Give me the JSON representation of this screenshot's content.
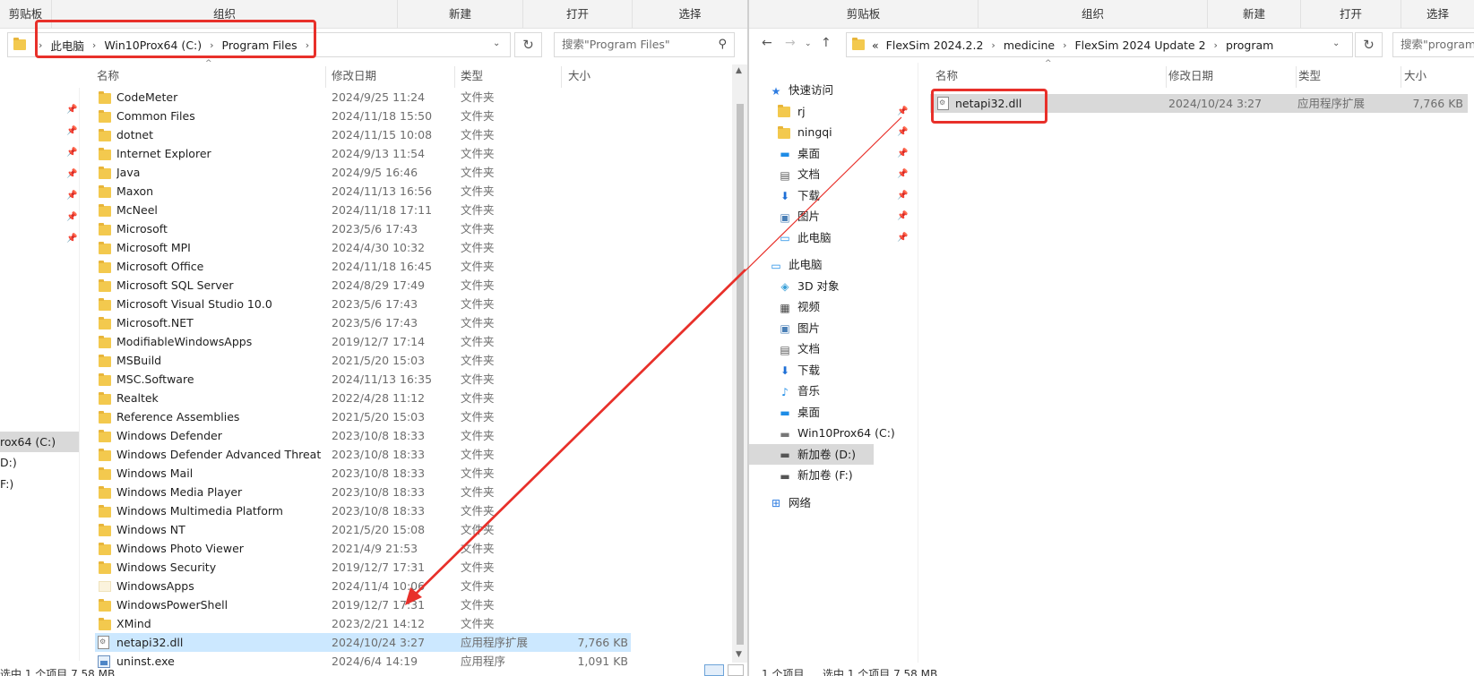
{
  "left": {
    "ribbon": [
      "剪贴板",
      "组织",
      "新建",
      "打开",
      "选择"
    ],
    "address": {
      "segments": [
        "此电脑",
        "Win10Prox64 (C:)",
        "Program Files"
      ]
    },
    "search_placeholder": "搜索\"Program Files\"",
    "columns": [
      "名称",
      "修改日期",
      "类型",
      "大小"
    ],
    "rows": [
      {
        "name": "CodeMeter",
        "date": "2024/9/25 11:24",
        "type": "文件夹",
        "size": "",
        "icon": "folder-icon"
      },
      {
        "name": "Common Files",
        "date": "2024/11/18 15:50",
        "type": "文件夹",
        "size": "",
        "icon": "folder-icon"
      },
      {
        "name": "dotnet",
        "date": "2024/11/15 10:08",
        "type": "文件夹",
        "size": "",
        "icon": "folder-icon"
      },
      {
        "name": "Internet Explorer",
        "date": "2024/9/13 11:54",
        "type": "文件夹",
        "size": "",
        "icon": "folder-icon"
      },
      {
        "name": "Java",
        "date": "2024/9/5 16:46",
        "type": "文件夹",
        "size": "",
        "icon": "folder-icon"
      },
      {
        "name": "Maxon",
        "date": "2024/11/13 16:56",
        "type": "文件夹",
        "size": "",
        "icon": "folder-icon"
      },
      {
        "name": "McNeel",
        "date": "2024/11/18 17:11",
        "type": "文件夹",
        "size": "",
        "icon": "folder-icon"
      },
      {
        "name": "Microsoft",
        "date": "2023/5/6 17:43",
        "type": "文件夹",
        "size": "",
        "icon": "folder-icon"
      },
      {
        "name": "Microsoft MPI",
        "date": "2024/4/30 10:32",
        "type": "文件夹",
        "size": "",
        "icon": "folder-icon"
      },
      {
        "name": "Microsoft Office",
        "date": "2024/11/18 16:45",
        "type": "文件夹",
        "size": "",
        "icon": "folder-icon"
      },
      {
        "name": "Microsoft SQL Server",
        "date": "2024/8/29 17:49",
        "type": "文件夹",
        "size": "",
        "icon": "folder-icon"
      },
      {
        "name": "Microsoft Visual Studio 10.0",
        "date": "2023/5/6 17:43",
        "type": "文件夹",
        "size": "",
        "icon": "folder-icon"
      },
      {
        "name": "Microsoft.NET",
        "date": "2023/5/6 17:43",
        "type": "文件夹",
        "size": "",
        "icon": "folder-icon"
      },
      {
        "name": "ModifiableWindowsApps",
        "date": "2019/12/7 17:14",
        "type": "文件夹",
        "size": "",
        "icon": "folder-icon"
      },
      {
        "name": "MSBuild",
        "date": "2021/5/20 15:03",
        "type": "文件夹",
        "size": "",
        "icon": "folder-icon"
      },
      {
        "name": "MSC.Software",
        "date": "2024/11/13 16:35",
        "type": "文件夹",
        "size": "",
        "icon": "folder-icon"
      },
      {
        "name": "Realtek",
        "date": "2022/4/28 11:12",
        "type": "文件夹",
        "size": "",
        "icon": "folder-icon"
      },
      {
        "name": "Reference Assemblies",
        "date": "2021/5/20 15:03",
        "type": "文件夹",
        "size": "",
        "icon": "folder-icon"
      },
      {
        "name": "Windows Defender",
        "date": "2023/10/8 18:33",
        "type": "文件夹",
        "size": "",
        "icon": "folder-icon"
      },
      {
        "name": "Windows Defender Advanced Threat ...",
        "date": "2023/10/8 18:33",
        "type": "文件夹",
        "size": "",
        "icon": "folder-icon"
      },
      {
        "name": "Windows Mail",
        "date": "2023/10/8 18:33",
        "type": "文件夹",
        "size": "",
        "icon": "folder-icon"
      },
      {
        "name": "Windows Media Player",
        "date": "2023/10/8 18:33",
        "type": "文件夹",
        "size": "",
        "icon": "folder-icon"
      },
      {
        "name": "Windows Multimedia Platform",
        "date": "2023/10/8 18:33",
        "type": "文件夹",
        "size": "",
        "icon": "folder-icon"
      },
      {
        "name": "Windows NT",
        "date": "2021/5/20 15:08",
        "type": "文件夹",
        "size": "",
        "icon": "folder-icon"
      },
      {
        "name": "Windows Photo Viewer",
        "date": "2021/4/9 21:53",
        "type": "文件夹",
        "size": "",
        "icon": "folder-icon"
      },
      {
        "name": "Windows Security",
        "date": "2019/12/7 17:31",
        "type": "文件夹",
        "size": "",
        "icon": "folder-icon"
      },
      {
        "name": "WindowsApps",
        "date": "2024/11/4 10:06",
        "type": "文件夹",
        "size": "",
        "icon": "windowsapps-folder-icon"
      },
      {
        "name": "WindowsPowerShell",
        "date": "2019/12/7 17:31",
        "type": "文件夹",
        "size": "",
        "icon": "folder-icon"
      },
      {
        "name": "XMind",
        "date": "2023/2/21 14:12",
        "type": "文件夹",
        "size": "",
        "icon": "folder-icon"
      },
      {
        "name": "netapi32.dll",
        "date": "2024/10/24 3:27",
        "type": "应用程序扩展",
        "size": "7,766 KB",
        "icon": "dll-file-icon",
        "selected": true
      },
      {
        "name": "uninst.exe",
        "date": "2024/6/4 14:19",
        "type": "应用程序",
        "size": "1,091 KB",
        "icon": "exe-file-icon"
      }
    ],
    "nav_fragments": [
      "rox64 (C:)",
      "D:)",
      "F:)"
    ],
    "status": "选中 1 个项目  7.58 MB"
  },
  "right": {
    "ribbon": [
      "剪贴板",
      "组织",
      "新建",
      "打开",
      "选择"
    ],
    "address": {
      "overflow": "«",
      "segments": [
        "FlexSim 2024.2.2",
        "medicine",
        "FlexSim 2024 Update 2",
        "program"
      ]
    },
    "search_placeholder": "搜索\"program",
    "columns": [
      "名称",
      "修改日期",
      "类型",
      "大小"
    ],
    "rows": [
      {
        "name": "netapi32.dll",
        "date": "2024/10/24 3:27",
        "type": "应用程序扩展",
        "size": "7,766 KB"
      }
    ],
    "nav": [
      {
        "label": "快速访问",
        "icon": "star-icon",
        "level": 0
      },
      {
        "label": "rj",
        "icon": "folder-icon",
        "level": 1,
        "pinned": true
      },
      {
        "label": "ningqi",
        "icon": "folder-icon",
        "level": 1,
        "pinned": true
      },
      {
        "label": "桌面",
        "icon": "desktop-icon",
        "level": 1,
        "pinned": true
      },
      {
        "label": "文档",
        "icon": "document-icon",
        "level": 1,
        "pinned": true
      },
      {
        "label": "下载",
        "icon": "download-icon",
        "level": 1,
        "pinned": true
      },
      {
        "label": "图片",
        "icon": "picture-icon",
        "level": 1,
        "pinned": true
      },
      {
        "label": "此电脑",
        "icon": "computer-icon",
        "level": 1,
        "pinned": true
      },
      {
        "label": "此电脑",
        "icon": "computer-icon",
        "level": 0
      },
      {
        "label": "3D 对象",
        "icon": "3d-objects-icon",
        "level": 1
      },
      {
        "label": "视频",
        "icon": "video-icon",
        "level": 1
      },
      {
        "label": "图片",
        "icon": "picture-icon",
        "level": 1
      },
      {
        "label": "文档",
        "icon": "document-icon",
        "level": 1
      },
      {
        "label": "下载",
        "icon": "download-icon",
        "level": 1
      },
      {
        "label": "音乐",
        "icon": "music-icon",
        "level": 1
      },
      {
        "label": "桌面",
        "icon": "desktop-icon",
        "level": 1
      },
      {
        "label": "Win10Prox64 (C:)",
        "icon": "system-drive-icon",
        "level": 1
      },
      {
        "label": "新加卷 (D:)",
        "icon": "drive-icon",
        "level": 1,
        "selected": true
      },
      {
        "label": "新加卷 (F:)",
        "icon": "drive-icon",
        "level": 1
      },
      {
        "label": "网络",
        "icon": "network-icon",
        "level": 0
      }
    ],
    "status_count": "1 个项目",
    "status_selected": "选中 1 个项目  7.58 MB"
  },
  "colors": {
    "highlight": "#e8302a",
    "selection": "#cce8ff",
    "selection_inactive": "#d9d9d9",
    "folder": "#f3c94e"
  }
}
